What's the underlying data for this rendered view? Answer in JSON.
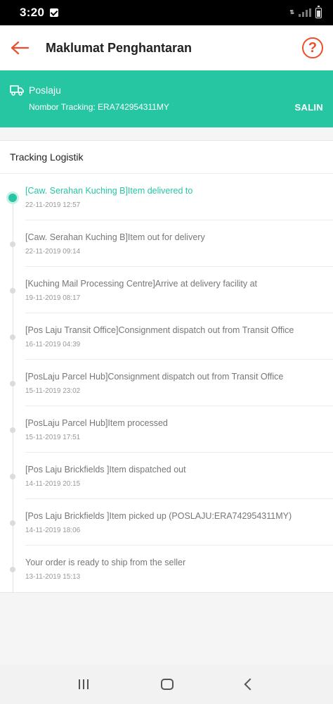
{
  "status_bar": {
    "time": "3:20"
  },
  "header": {
    "title": "Maklumat Penghantaran",
    "help_icon": "?"
  },
  "courier": {
    "name": "Poslaju",
    "tracking_label": "Nombor Tracking:",
    "tracking_number": "ERA742954311MY",
    "copy_label": "SALIN"
  },
  "tracking": {
    "title": "Tracking Logistik",
    "events": [
      {
        "text": "[Caw. Serahan Kuching B]Item delivered to",
        "time": "22-11-2019 12:57"
      },
      {
        "text": "[Caw. Serahan Kuching B]Item out for delivery",
        "time": "22-11-2019 09:14"
      },
      {
        "text": "[Kuching Mail Processing Centre]Arrive at delivery facility at",
        "time": "19-11-2019 08:17"
      },
      {
        "text": "[Pos Laju Transit Office]Consignment dispatch out from Transit Office",
        "time": "16-11-2019 04:39"
      },
      {
        "text": "[PosLaju Parcel Hub]Consignment dispatch out from Transit Office",
        "time": "15-11-2019 23:02"
      },
      {
        "text": "[PosLaju Parcel Hub]Item processed",
        "time": "15-11-2019 17:51"
      },
      {
        "text": "[Pos Laju Brickfields ]Item dispatched out",
        "time": "14-11-2019 20:15"
      },
      {
        "text": "[Pos Laju Brickfields ]Item picked up (POSLAJU:ERA742954311MY)",
        "time": "14-11-2019 18:06"
      },
      {
        "text": "Your order is ready to ship from the seller",
        "time": "13-11-2019 15:13"
      }
    ]
  },
  "colors": {
    "accent": "#26c6a3",
    "brand": "#ee4d2d"
  }
}
